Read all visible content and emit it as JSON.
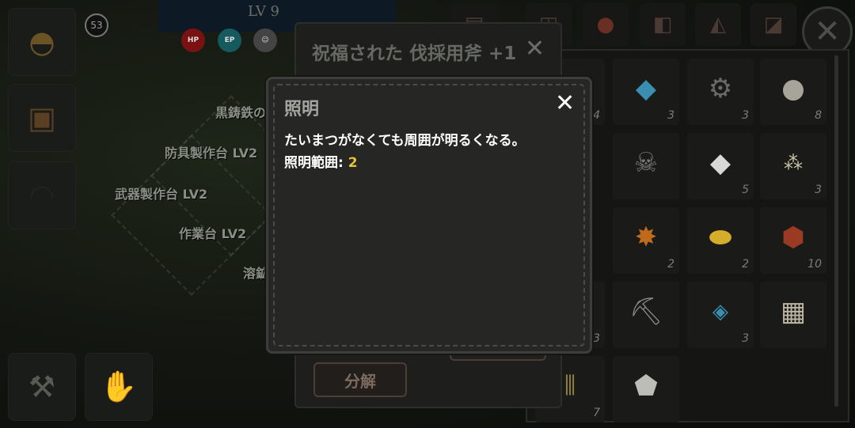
{
  "hud": {
    "level": "LV 9",
    "player_badge": "53",
    "stats": [
      {
        "label": "HP",
        "color": "#b3181b"
      },
      {
        "label": "EP",
        "color": "#1b7f84"
      }
    ]
  },
  "map_labels": [
    "黒鋳鉄の",
    "防具製作台 LV2",
    "武器製作台 LV2",
    "作業台 LV2",
    "溶鉱"
  ],
  "detail_panel": {
    "title": "祝福された 伐採用斧 +1",
    "disassemble_label": "分解"
  },
  "tooltip": {
    "title": "照明",
    "description": "たいまつがなくても周囲が明るくなる。",
    "stat_label": "照明範囲:",
    "stat_value": "2",
    "stat_value_color": "#e5c33a"
  },
  "inventory": {
    "slots": [
      {
        "icon": "blue-crystal-icon",
        "count": "3"
      },
      {
        "icon": "gear-icon",
        "count": "3"
      },
      {
        "icon": "ore-ball-icon",
        "count": "8"
      },
      {
        "icon": "bone-icon",
        "count": ""
      },
      {
        "icon": "white-stone-icon",
        "count": "5"
      },
      {
        "icon": "seeds-icon",
        "count": "3"
      },
      {
        "icon": "orange-hide-icon",
        "count": "2"
      },
      {
        "icon": "yellow-ore-icon",
        "count": "2"
      },
      {
        "icon": "red-ore-icon",
        "count": "10"
      },
      {
        "icon": "pickaxe-icon",
        "count": ""
      },
      {
        "icon": "blue-shard-icon",
        "count": "3"
      },
      {
        "icon": "map-scroll-icon",
        "count": ""
      },
      {
        "icon": "grey-rock-icon",
        "count": ""
      }
    ],
    "partial_counts": [
      "4",
      "3",
      "3",
      "7"
    ]
  }
}
